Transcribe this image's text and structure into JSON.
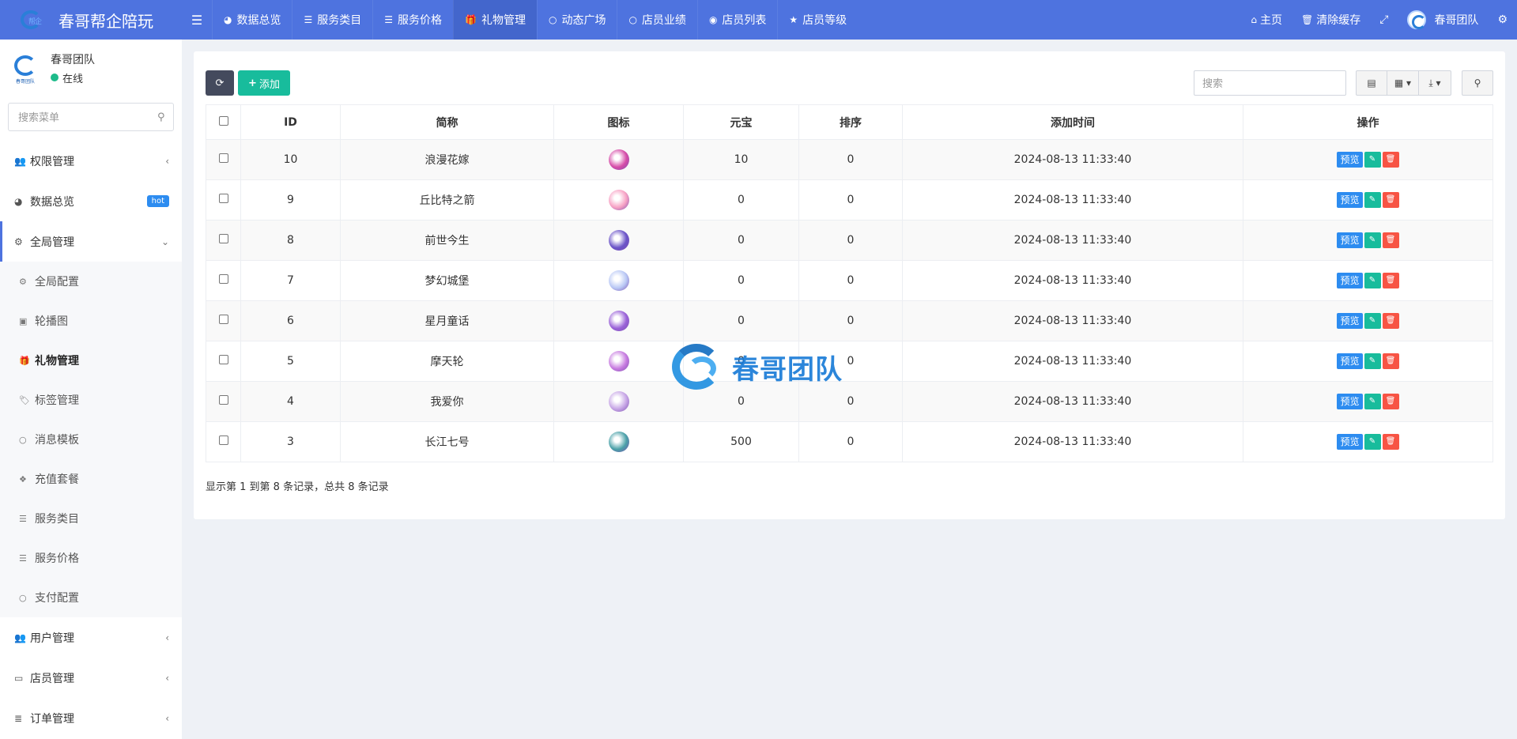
{
  "app": {
    "title": "春哥帮企陪玩",
    "logo_text": "帮企"
  },
  "topnav": [
    {
      "icon": "dashboard-icon",
      "glyph": "◕",
      "label": "数据总览"
    },
    {
      "icon": "list-icon",
      "glyph": "☰",
      "label": "服务类目"
    },
    {
      "icon": "list-icon",
      "glyph": "☰",
      "label": "服务价格"
    },
    {
      "icon": "gift-icon",
      "glyph": "🎁",
      "label": "礼物管理"
    },
    {
      "icon": "circle-icon",
      "glyph": "○",
      "label": "动态广场"
    },
    {
      "icon": "circle-icon",
      "glyph": "○",
      "label": "店员业绩"
    },
    {
      "icon": "user-circle-icon",
      "glyph": "◉",
      "label": "店员列表"
    },
    {
      "icon": "star-icon",
      "glyph": "★",
      "label": "店员等级"
    }
  ],
  "topright": {
    "home": "主页",
    "clear_cache": "清除缓存",
    "username": "春哥团队"
  },
  "user": {
    "name": "春哥团队",
    "status": "在线",
    "avatar_caption": "春哥团队"
  },
  "sidebar": {
    "search_placeholder": "搜索菜单",
    "items": [
      {
        "label": "权限管理",
        "icon": "users-icon"
      },
      {
        "label": "数据总览",
        "icon": "dashboard-icon",
        "badge": "hot"
      },
      {
        "label": "全局管理",
        "icon": "cogs-icon"
      }
    ],
    "sub_items": [
      {
        "label": "全局配置",
        "icon": "gear-icon"
      },
      {
        "label": "轮播图",
        "icon": "image-icon"
      },
      {
        "label": "礼物管理",
        "icon": "gift-icon"
      },
      {
        "label": "标签管理",
        "icon": "tags-icon"
      },
      {
        "label": "消息模板",
        "icon": "circle-icon"
      },
      {
        "label": "充值套餐",
        "icon": "cubes-icon"
      },
      {
        "label": "服务类目",
        "icon": "list-icon"
      },
      {
        "label": "服务价格",
        "icon": "list-icon"
      },
      {
        "label": "支付配置",
        "icon": "circle-icon"
      }
    ],
    "bottom_items": [
      {
        "label": "用户管理",
        "icon": "users-icon"
      },
      {
        "label": "店员管理",
        "icon": "id-card-icon"
      },
      {
        "label": "订单管理",
        "icon": "database-icon"
      }
    ]
  },
  "toolbar": {
    "add_label": "添加",
    "search_placeholder": "搜索"
  },
  "table": {
    "columns": [
      "ID",
      "简称",
      "图标",
      "元宝",
      "排序",
      "添加时间",
      "操作"
    ],
    "preview_label": "预览",
    "rows": [
      {
        "id": "10",
        "name": "浪漫花嫁",
        "icon_color": "#d64ca8",
        "yuanbao": "10",
        "sort": "0",
        "time": "2024-08-13 11:33:40"
      },
      {
        "id": "9",
        "name": "丘比特之箭",
        "icon_color": "#f7a1c4",
        "yuanbao": "0",
        "sort": "0",
        "time": "2024-08-13 11:33:40"
      },
      {
        "id": "8",
        "name": "前世今生",
        "icon_color": "#6b54c8",
        "yuanbao": "0",
        "sort": "0",
        "time": "2024-08-13 11:33:40"
      },
      {
        "id": "7",
        "name": "梦幻城堡",
        "icon_color": "#b9c8f5",
        "yuanbao": "0",
        "sort": "0",
        "time": "2024-08-13 11:33:40"
      },
      {
        "id": "6",
        "name": "星月童话",
        "icon_color": "#9a62d8",
        "yuanbao": "0",
        "sort": "0",
        "time": "2024-08-13 11:33:40"
      },
      {
        "id": "5",
        "name": "摩天轮",
        "icon_color": "#c77be0",
        "yuanbao": "0",
        "sort": "0",
        "time": "2024-08-13 11:33:40"
      },
      {
        "id": "4",
        "name": "我爱你",
        "icon_color": "#c7a6e6",
        "yuanbao": "0",
        "sort": "0",
        "time": "2024-08-13 11:33:40"
      },
      {
        "id": "3",
        "name": "长江七号",
        "icon_color": "#4aa1a8",
        "yuanbao": "500",
        "sort": "0",
        "time": "2024-08-13 11:33:40"
      }
    ]
  },
  "pagination": {
    "info": "显示第 1 到第 8 条记录，总共 8 条记录"
  },
  "watermark": {
    "text": "春哥团队"
  },
  "colors": {
    "topbar": "#4e73df",
    "add": "#18bc9c",
    "preview": "#2d8cf0",
    "delete": "#f75444",
    "online": "#1dbb8a"
  }
}
